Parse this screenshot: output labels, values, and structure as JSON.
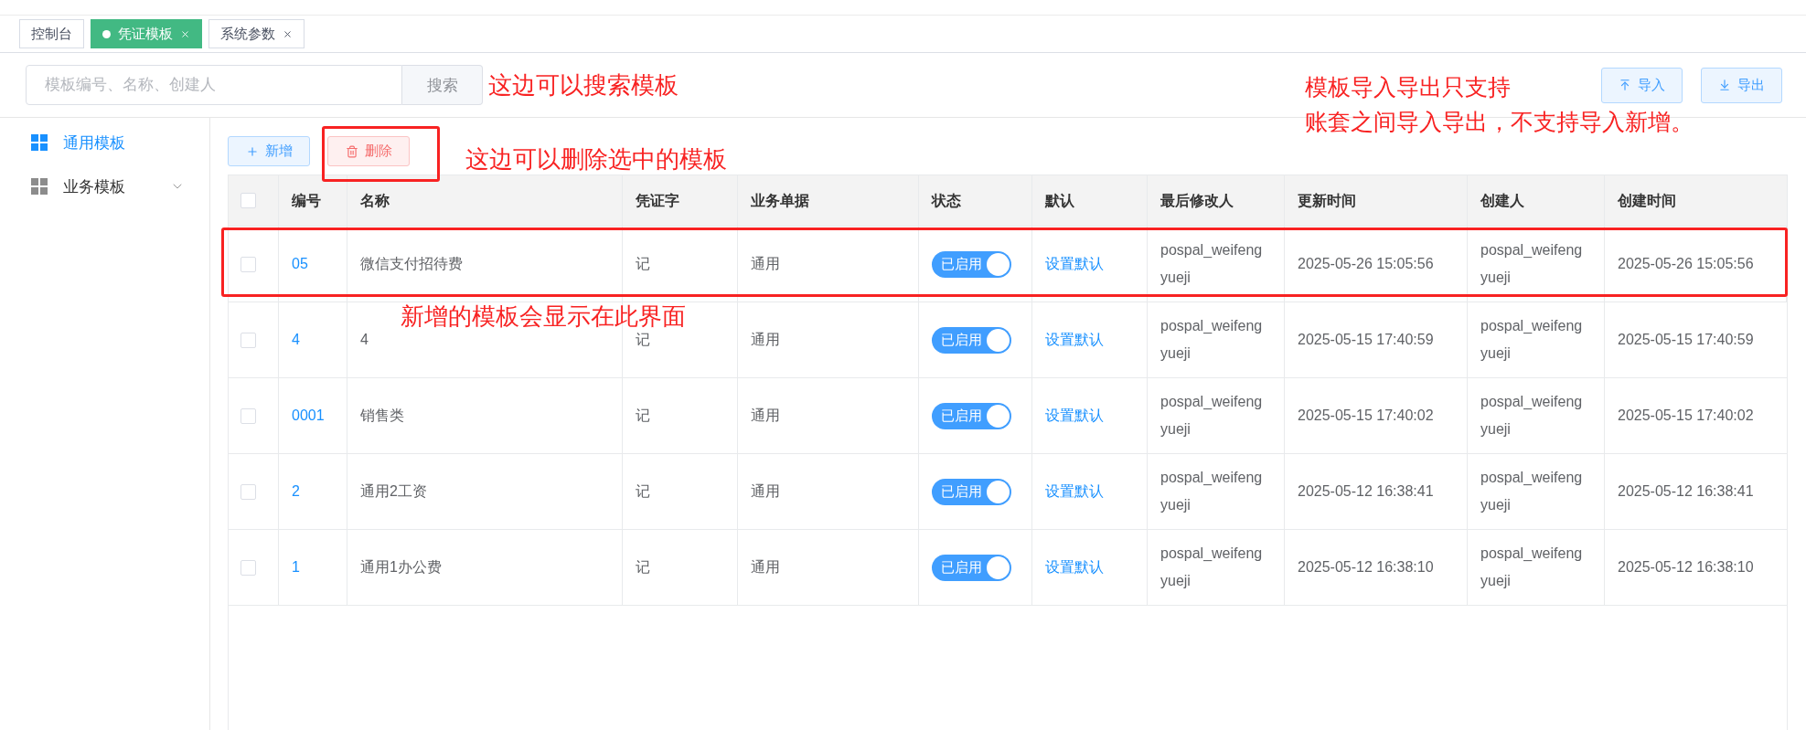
{
  "tabs": [
    {
      "label": "控制台",
      "selected": false,
      "closable": false
    },
    {
      "label": "凭证模板",
      "selected": true,
      "closable": true
    },
    {
      "label": "系统参数",
      "selected": false,
      "closable": true
    }
  ],
  "search": {
    "placeholder": "模板编号、名称、创建人",
    "button": "搜索",
    "note": "这边可以搜索模板"
  },
  "transfer": {
    "note_lines": [
      "模板导入导出只支持",
      "账套之间导入导出，不支持导入新增。"
    ],
    "buttons": [
      {
        "label": "导入",
        "kind": "import"
      },
      {
        "label": "导出",
        "kind": "export"
      }
    ]
  },
  "sidebar": {
    "items": [
      {
        "label": "通用模板",
        "selected": true,
        "expandable": false
      },
      {
        "label": "业务模板",
        "selected": false,
        "expandable": true
      }
    ]
  },
  "actions": [
    {
      "label": "新增",
      "kind": "add",
      "highlighted": false
    },
    {
      "label": "删除",
      "kind": "delete",
      "highlighted": true,
      "note": "这边可以删除选中的模板"
    }
  ],
  "table": {
    "all_checked": false,
    "columns": [
      "编号",
      "名称",
      "凭证字",
      "业务单据",
      "状态",
      "默认",
      "最后修改人",
      "更新时间",
      "创建人",
      "创建时间"
    ],
    "rows": [
      {
        "checked": false,
        "highlighted": true,
        "note": "新增的模板会显示在此界面",
        "code": "05",
        "name": "微信支付招待费",
        "voucher_word": "记",
        "document": "通用",
        "status": {
          "label": "已启用",
          "on": true
        },
        "default_action": "设置默认",
        "modified_by": "pospal_weifeng yueji",
        "updated_at": "2025-05-26 15:05:56",
        "created_by": "pospal_weifeng yueji",
        "created_at": "2025-05-26 15:05:56"
      },
      {
        "checked": false,
        "highlighted": false,
        "code": "4",
        "name": "4",
        "voucher_word": "记",
        "document": "通用",
        "status": {
          "label": "已启用",
          "on": true
        },
        "default_action": "设置默认",
        "modified_by": "pospal_weifeng yueji",
        "updated_at": "2025-05-15 17:40:59",
        "created_by": "pospal_weifeng yueji",
        "created_at": "2025-05-15 17:40:59"
      },
      {
        "checked": false,
        "highlighted": false,
        "code": "0001",
        "name": "销售类",
        "voucher_word": "记",
        "document": "通用",
        "status": {
          "label": "已启用",
          "on": true
        },
        "default_action": "设置默认",
        "modified_by": "pospal_weifeng yueji",
        "updated_at": "2025-05-15 17:40:02",
        "created_by": "pospal_weifeng yueji",
        "created_at": "2025-05-15 17:40:02"
      },
      {
        "checked": false,
        "highlighted": false,
        "code": "2",
        "name": "通用2工资",
        "voucher_word": "记",
        "document": "通用",
        "status": {
          "label": "已启用",
          "on": true
        },
        "default_action": "设置默认",
        "modified_by": "pospal_weifeng yueji",
        "updated_at": "2025-05-12 16:38:41",
        "created_by": "pospal_weifeng yueji",
        "created_at": "2025-05-12 16:38:41"
      },
      {
        "checked": false,
        "highlighted": false,
        "code": "1",
        "name": "通用1办公费",
        "voucher_word": "记",
        "document": "通用",
        "status": {
          "label": "已启用",
          "on": true
        },
        "default_action": "设置默认",
        "modified_by": "pospal_weifeng yueji",
        "updated_at": "2025-05-12 16:38:10",
        "created_by": "pospal_weifeng yueji",
        "created_at": "2025-05-12 16:38:10"
      }
    ]
  }
}
